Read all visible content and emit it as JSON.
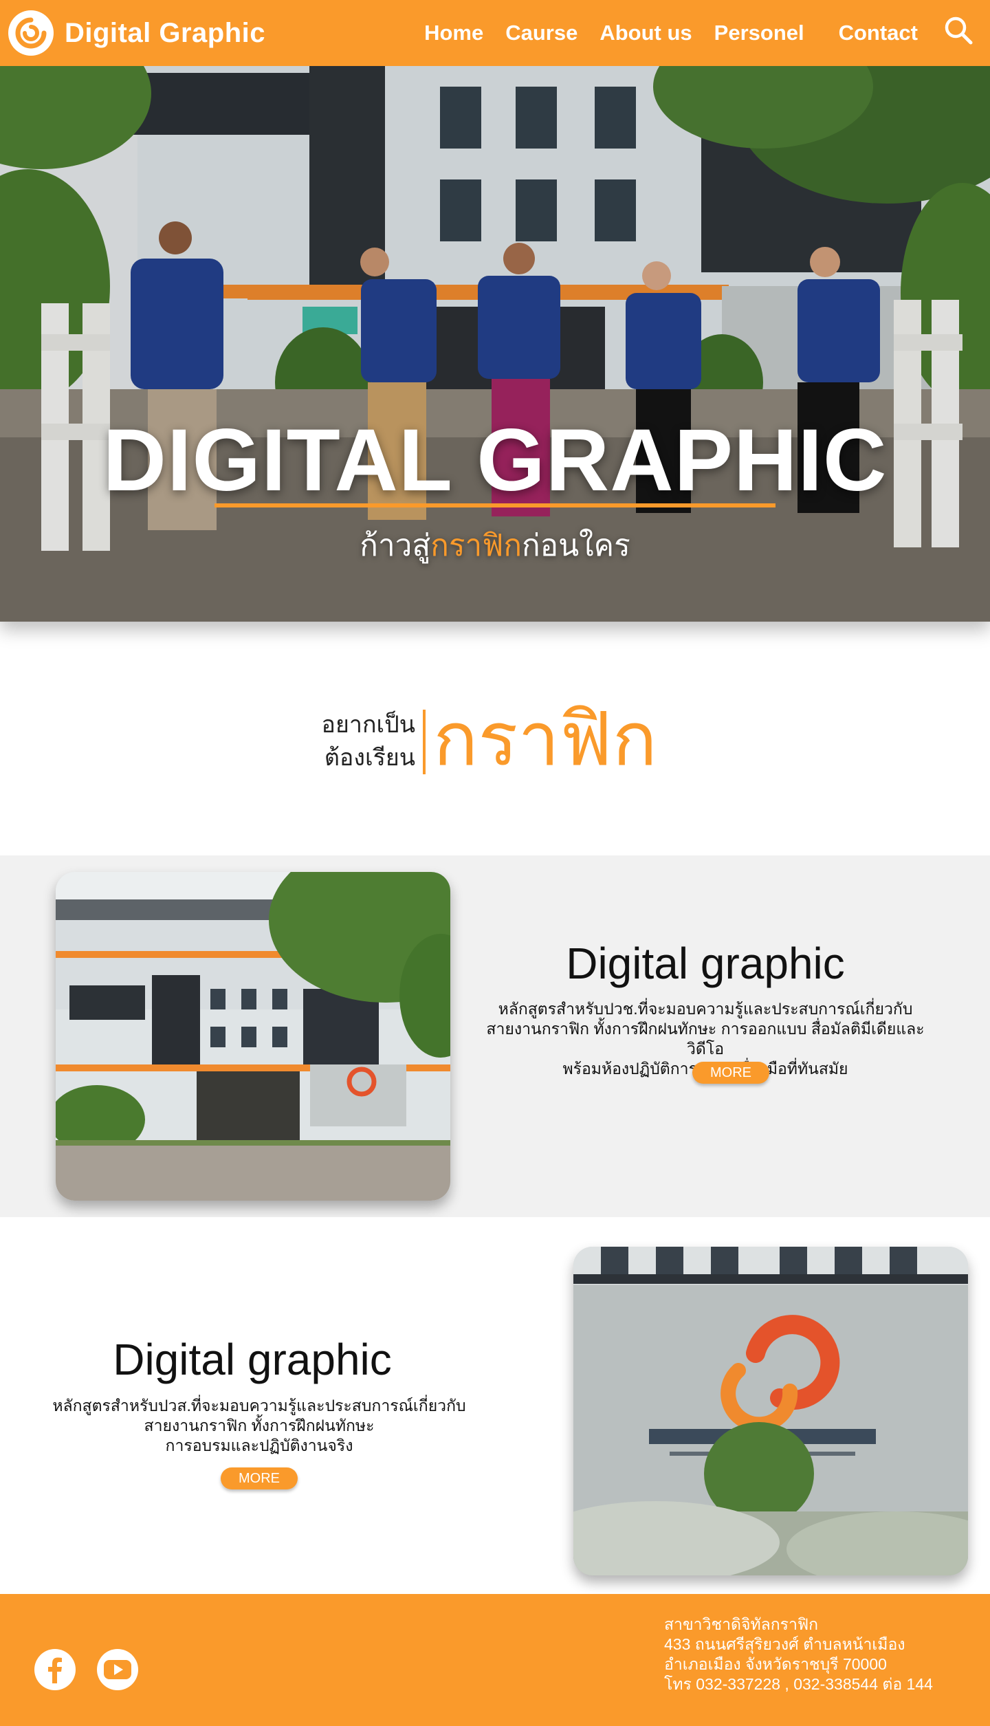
{
  "brand": {
    "name": "Digital Graphic",
    "logo_icon": "digital-graphic-logo-icon"
  },
  "nav": {
    "items": [
      "Home",
      "Caurse",
      "About us",
      "Personel",
      "Contact"
    ],
    "search_icon": "search-icon"
  },
  "hero": {
    "title": "DIGITAL GRAPHIC",
    "subtitle_pre": "ก้าวสู่",
    "subtitle_accent": "กราฟิก",
    "subtitle_post": "ก่อนใคร"
  },
  "tagline": {
    "line1": "อยากเป็น",
    "line2": "ต้องเรียน",
    "big": "กราฟิก"
  },
  "programs": [
    {
      "title": "Digital graphic",
      "desc_lines": [
        "หลักสูตรสำหรับปวช.ที่จะมอบความรู้และประสบการณ์เกี่ยวกับ",
        "สายงานกราฟิก ทั้งการฝึกฝนทักษะ การออกแบบ สื่อมัลติมีเดียและวิดีโอ",
        "พร้อมห้องปฏิบัติการและเครื่องมือที่ทันสมัย"
      ],
      "button": "MORE"
    },
    {
      "title": "Digital graphic",
      "desc_lines": [
        "หลักสูตรสำหรับปวส.ที่จะมอบความรู้และประสบการณ์เกี่ยวกับ",
        "สายงานกราฟิก ทั้งการฝึกฝนทักษะ",
        "การอบรมและปฏิบัติงานจริง"
      ],
      "button": "MORE"
    }
  ],
  "footer": {
    "social_icons": [
      "facebook-icon",
      "youtube-icon"
    ],
    "address_lines": [
      "สาขาวิชาดิจิทัลกราฟิก",
      "433 ถนนศรีสุริยวงศ์ ตำบลหน้าเมือง",
      "อำเภอเมือง จังหวัดราชบุรี 70000",
      "โทร 032-337228 , 032-338544 ต่อ 144"
    ]
  },
  "colors": {
    "brand_orange": "#fa9a2b",
    "section_gray": "#f1f1f1",
    "shirt_blue": "#23408e"
  }
}
